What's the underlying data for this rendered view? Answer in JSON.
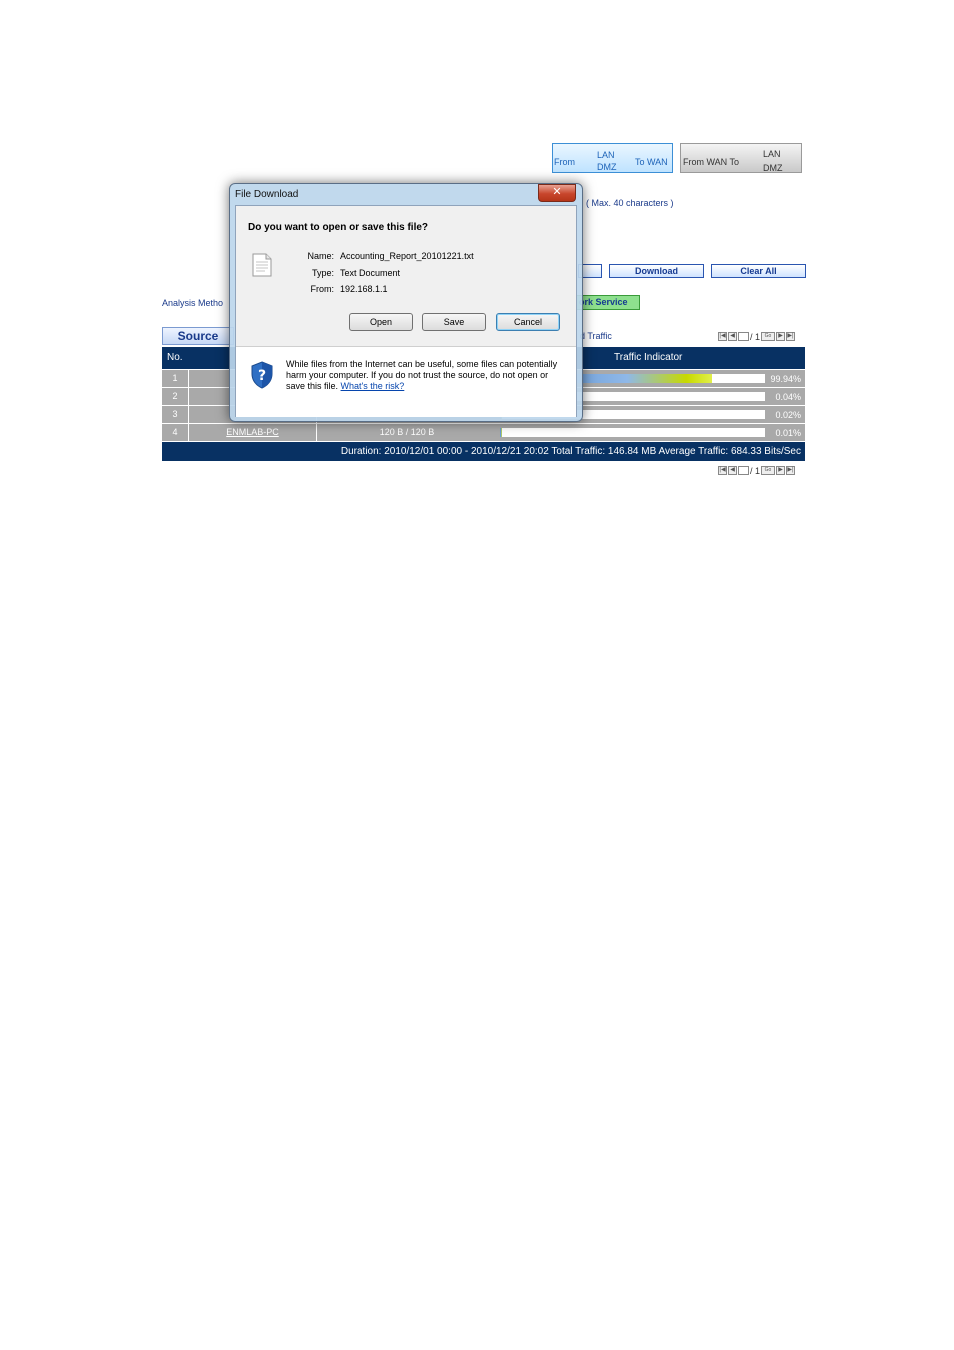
{
  "direction_tabs": {
    "lan_to_wan": {
      "from": "From",
      "lan": "LAN",
      "dmz": "DMZ",
      "to": "To WAN"
    },
    "wan_to_lan": {
      "from": "From WAN To",
      "lan": "LAN",
      "dmz": "DMZ"
    }
  },
  "hint": "( Max. 40 characters )",
  "actions": {
    "download": "Download",
    "clear_all": "Clear All"
  },
  "analysis": {
    "label": "Analysis Metho",
    "service_tab": "ork Service"
  },
  "source_tab": "Source",
  "traffic_tab_label": "d Traffic",
  "pager": {
    "page_total": "/ 1",
    "go": "Go"
  },
  "table": {
    "headers": {
      "no": "No.",
      "indicator": "Traffic Indicator"
    },
    "rows": [
      {
        "no": "1",
        "host": "",
        "traffic": "",
        "percent": "99.94%",
        "level": 0.9994
      },
      {
        "no": "2",
        "host": "",
        "traffic": "",
        "percent": "0.04%",
        "level": 0.0004
      },
      {
        "no": "3",
        "host": "",
        "traffic": "",
        "percent": "0.02%",
        "level": 0.0002
      },
      {
        "no": "4",
        "host": "ENMLAB-PC",
        "traffic": "120 B / 120 B",
        "percent": "0.01%",
        "level": 0.0001
      }
    ],
    "footer": "Duration: 2010/12/01 00:00 - 2010/12/21 20:02   Total Traffic: 146.84 MB   Average Traffic: 684.33 Bits/Sec"
  },
  "dialog": {
    "title": "File Download",
    "close": "✕",
    "question": "Do you want to open or save this file?",
    "name_label": "Name:",
    "name": "Accounting_Report_20101221.txt",
    "type_label": "Type:",
    "type": "Text Document",
    "from_label": "From:",
    "from": "192.168.1.1",
    "open": "Open",
    "save": "Save",
    "cancel": "Cancel",
    "warning": "While files from the Internet can be useful, some files can potentially harm your computer. If you do not trust the source, do not open or save this file.",
    "risk_link": "What's the risk?"
  }
}
